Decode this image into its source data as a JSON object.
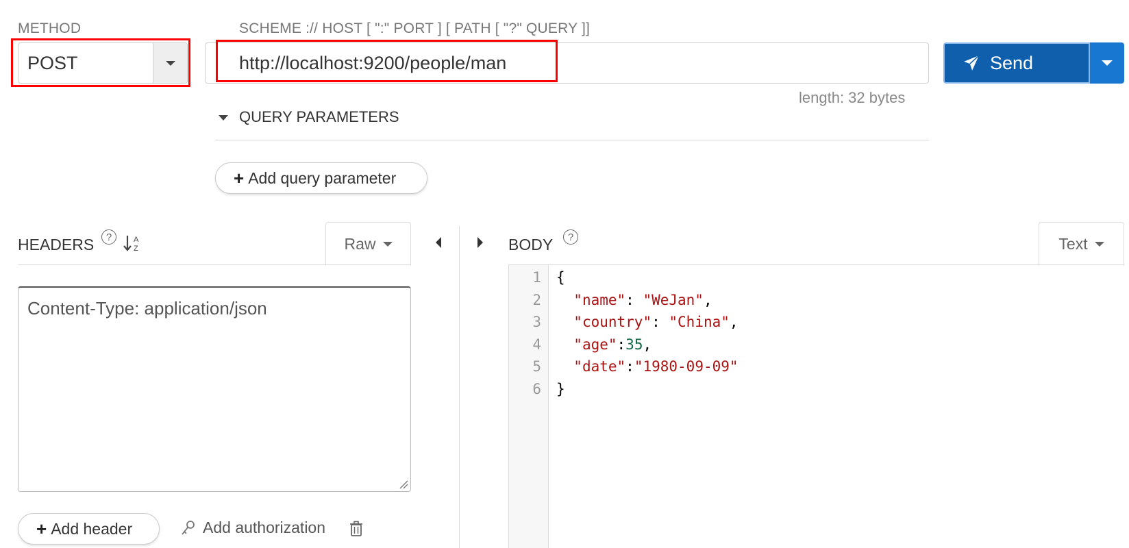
{
  "method": {
    "label": "METHOD",
    "value": "POST"
  },
  "url": {
    "label": "SCHEME :// HOST [ \":\" PORT ] [ PATH [ \"?\" QUERY ]]",
    "value": "http://localhost:9200/people/man",
    "length_text": "length: 32 bytes"
  },
  "send": {
    "label": "Send"
  },
  "query_params": {
    "title": "QUERY PARAMETERS",
    "add_label": "Add query parameter"
  },
  "headers": {
    "title": "HEADERS",
    "mode": "Raw",
    "content": "Content-Type: application/json",
    "add_header_label": "Add header",
    "add_auth_label": "Add authorization"
  },
  "body": {
    "title": "BODY",
    "mode": "Text",
    "lines": [
      {
        "num": "1",
        "parts": [
          {
            "t": "{",
            "c": "p"
          }
        ]
      },
      {
        "num": "2",
        "parts": [
          {
            "t": "  ",
            "c": "p"
          },
          {
            "t": "\"name\"",
            "c": "s"
          },
          {
            "t": ": ",
            "c": "p"
          },
          {
            "t": "\"WeJan\"",
            "c": "s"
          },
          {
            "t": ",",
            "c": "p"
          }
        ]
      },
      {
        "num": "3",
        "parts": [
          {
            "t": "  ",
            "c": "p"
          },
          {
            "t": "\"country\"",
            "c": "s"
          },
          {
            "t": ": ",
            "c": "p"
          },
          {
            "t": "\"China\"",
            "c": "s"
          },
          {
            "t": ",",
            "c": "p"
          }
        ]
      },
      {
        "num": "4",
        "parts": [
          {
            "t": "  ",
            "c": "p"
          },
          {
            "t": "\"age\"",
            "c": "s"
          },
          {
            "t": ":",
            "c": "p"
          },
          {
            "t": "35",
            "c": "n"
          },
          {
            "t": ",",
            "c": "p"
          }
        ]
      },
      {
        "num": "5",
        "parts": [
          {
            "t": "  ",
            "c": "p"
          },
          {
            "t": "\"date\"",
            "c": "s"
          },
          {
            "t": ":",
            "c": "p"
          },
          {
            "t": "\"1980-09-09\"",
            "c": "s"
          }
        ]
      },
      {
        "num": "6",
        "parts": [
          {
            "t": "}",
            "c": "p"
          }
        ]
      }
    ]
  },
  "colors": {
    "send_bg": "#0f5fad",
    "send_dropdown_bg": "#1877d1",
    "highlight": "#ff0000",
    "json_string": "#a11",
    "json_number": "#164"
  },
  "icons": [
    "caret-down-icon",
    "paper-plane-icon",
    "help-icon",
    "sort-az-icon",
    "plus-icon",
    "key-icon",
    "trash-icon",
    "caret-left-icon",
    "caret-right-icon"
  ]
}
